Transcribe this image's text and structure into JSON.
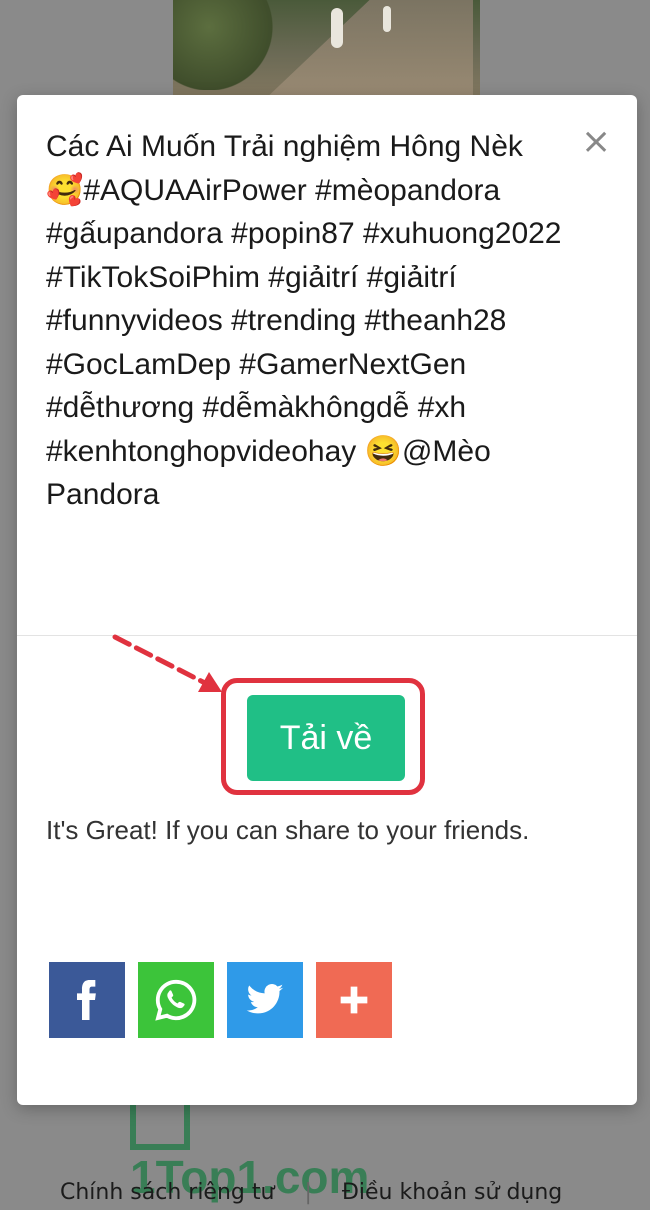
{
  "modal": {
    "title": "Các Ai Muốn Trải nghiệm Hông Nèk 🥰#AQUAAirPower #mèopandora #gấupandora #popin87 #xuhuong2022 #TikTokSoiPhim #giảitrí #giảitrí #funnyvideos #trending #theanh28 #GocLamDep #GamerNextGen #dễthương #dễmàkhôngdễ #xh #kenhtonghopvideohay 😆@Mèo Pandora",
    "close_label": "×",
    "download_label": "Tải về",
    "share_text": "It's Great! If you can share to your friends.",
    "share_buttons": [
      {
        "icon": "facebook-icon",
        "color": "#3b5998"
      },
      {
        "icon": "whatsapp-icon",
        "color": "#3cc43a"
      },
      {
        "icon": "twitter-icon",
        "color": "#2f9ae8"
      },
      {
        "icon": "plus-icon",
        "color": "#f06a54"
      }
    ],
    "download_color": "#20bf86",
    "highlight_color": "#e0323f"
  },
  "background": {
    "logo_text": "1Top1.com",
    "footer_links": [
      "Chính sách riêng tư",
      "Điều khoản sử dụng"
    ]
  }
}
